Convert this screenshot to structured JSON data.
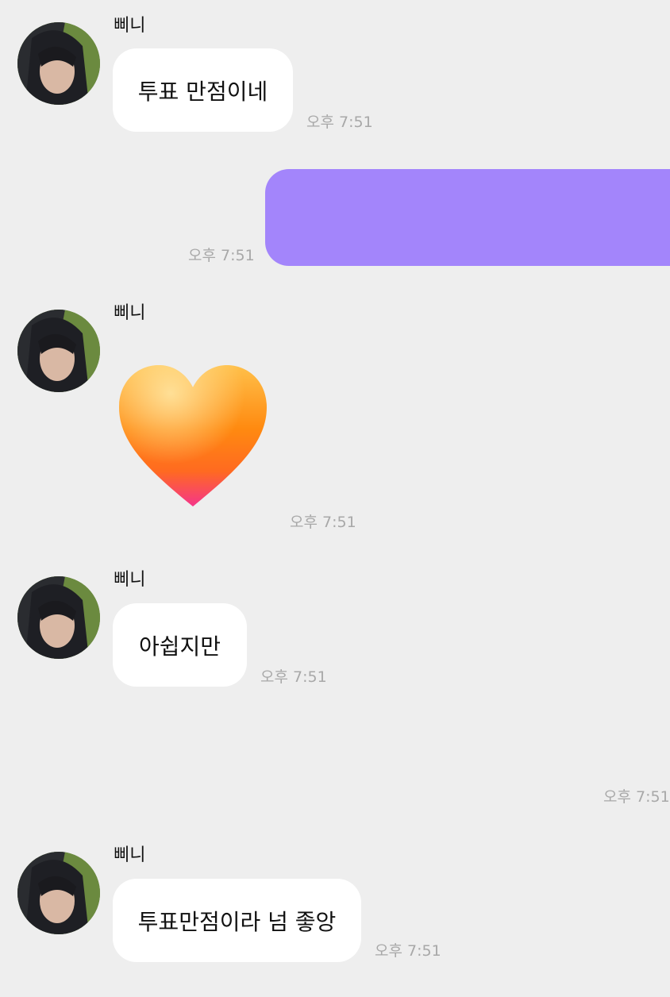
{
  "messages": [
    {
      "sender": "삐니",
      "text": "투표 만점이네",
      "time": "오후 7:51"
    },
    {
      "mine": true,
      "text": "",
      "time": "오후 7:51"
    },
    {
      "sender": "삐니",
      "sticker": "orange-heart",
      "time": "오후 7:51"
    },
    {
      "sender": "삐니",
      "text": "아쉽지만",
      "time": "오후 7:51"
    },
    {
      "mine": true,
      "time": "오후 7:51"
    },
    {
      "sender": "삐니",
      "text": "투표만점이라 넘 좋앙",
      "time": "오후 7:51"
    }
  ],
  "colors": {
    "background": "#eeeeee",
    "incoming_bubble": "#ffffff",
    "outgoing_bubble": "#a385fb",
    "timestamp": "#a8a8a8"
  }
}
